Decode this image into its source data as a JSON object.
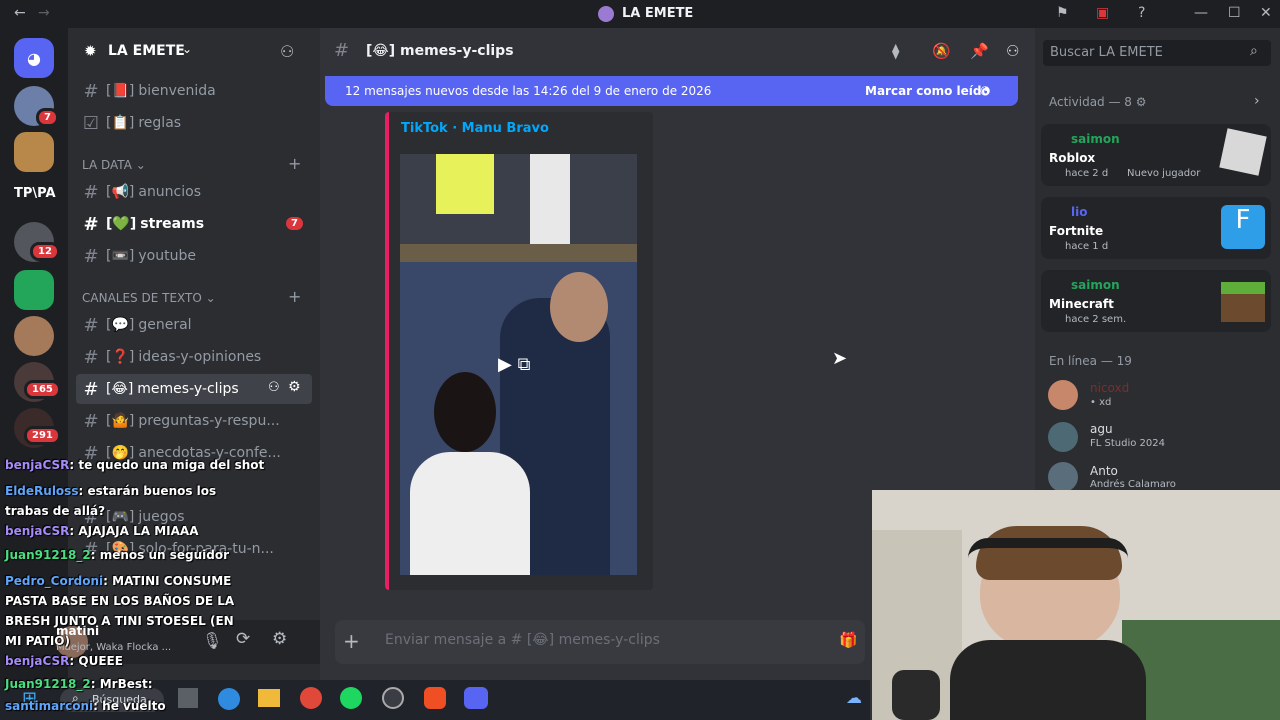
{
  "window": {
    "title": "LA EMETE"
  },
  "server": {
    "name": "LA EMETE"
  },
  "channels": {
    "top": [
      {
        "icon": "[📕]",
        "label": "bienvenida"
      },
      {
        "icon": "[📋]",
        "label": "reglas"
      }
    ],
    "cat1": "LA DATA",
    "data": [
      {
        "icon": "[📢]",
        "label": "anuncios"
      },
      {
        "icon": "[💚]",
        "label": "streams",
        "badge": "7"
      },
      {
        "icon": "[📼]",
        "label": "youtube"
      }
    ],
    "cat2": "CANALES DE TEXTO",
    "text": [
      {
        "icon": "[💬]",
        "label": "general"
      },
      {
        "icon": "[❓]",
        "label": "ideas-y-opiniones"
      },
      {
        "icon": "[😂]",
        "label": "memes-y-clips"
      },
      {
        "icon": "[🤷]",
        "label": "preguntas-y-respu..."
      },
      {
        "icon": "[🤭]",
        "label": "anecdotas-y-confe..."
      },
      {
        "icon": "[🎮]",
        "label": "juegos"
      },
      {
        "icon": "[🎨]",
        "label": "solo-for-para-tu-n..."
      }
    ]
  },
  "user_panel": {
    "name": "matini",
    "status": "Maejor, Waka Flocka ..."
  },
  "rail_badges": [
    "7",
    "12",
    "165",
    "291"
  ],
  "rail_label": "TP\\PA",
  "header": {
    "channel": "[😂] memes-y-clips"
  },
  "banner": {
    "text": "12 mensajes nuevos desde las 14:26 del 9 de enero de 2026",
    "action": "Marcar como leído"
  },
  "embed": {
    "provider": "TikTok · Manu Bravo"
  },
  "composer": {
    "placeholder": "Enviar mensaje a # [😂] memes-y-clips"
  },
  "search": {
    "placeholder": "Buscar LA EMETE"
  },
  "activity": {
    "header": "Actividad — 8",
    "cards": [
      {
        "user": "saimon",
        "game": "Roblox",
        "time": "hace 2 d",
        "extra": "Nuevo jugador"
      },
      {
        "user": "lio",
        "game": "Fortnite",
        "time": "hace 1 d",
        "extra": ""
      },
      {
        "user": "saimon",
        "game": "Minecraft",
        "time": "hace 2 sem.",
        "extra": ""
      }
    ]
  },
  "online": {
    "header": "En línea — 19",
    "members": [
      {
        "name": "nicoxd",
        "status": "• xd"
      },
      {
        "name": "agu",
        "status": "FL Studio 2024"
      },
      {
        "name": "Anto",
        "status": "Andrés Calamaro"
      }
    ]
  },
  "chat": [
    {
      "user": "benjaCSR",
      "msg": ": te quedo una miga del shot"
    },
    {
      "user": "EldeRuloss",
      "msg": ": estarán buenos los trabas de allá?"
    },
    {
      "user": "benjaCSR",
      "msg": ": AJAJAJA LA MIAAA"
    },
    {
      "user": "Juan91218_2",
      "msg": ": menos un seguidor"
    },
    {
      "user": "Pedro_Cordoni",
      "msg": ": MATINI CONSUME PASTA BASE EN LOS BAÑOS DE LA BRESH JUNTO A TINI STOESEL (EN MI PATIO)"
    },
    {
      "user": "benjaCSR",
      "msg": ": QUEEE"
    },
    {
      "user": "Juan91218_2",
      "msg": ": MrBest:"
    },
    {
      "user": "santimarconi",
      "msg": ": he vuelto"
    }
  ],
  "taskbar": {
    "search": "Búsqueda"
  },
  "colors": {
    "accent": "#5865f2",
    "embed_bar": "#e91e63",
    "badge": "#da373c"
  }
}
